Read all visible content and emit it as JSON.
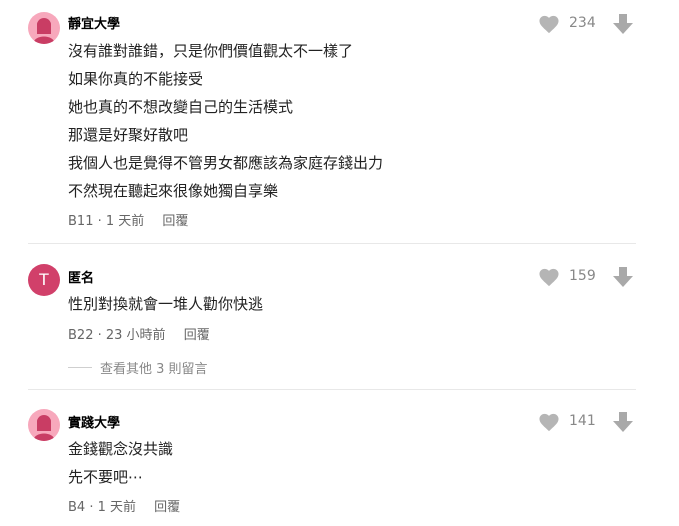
{
  "comments": [
    {
      "author": "靜宜大學",
      "lines": [
        "沒有誰對誰錯，只是你們價值觀太不一樣了",
        "如果你真的不能接受",
        "她也真的不想改變自己的生活模式",
        "那還是好聚好散吧",
        "我個人也是覺得不管男女都應該為家庭存錢出力",
        "不然現在聽起來很像她獨自享樂"
      ],
      "floor": "B11",
      "time": "1 天前",
      "reply_label": "回覆",
      "likes": "234"
    },
    {
      "author": "匿名",
      "avatar_letter": "T",
      "lines": [
        "性別對換就會一堆人勸你快逃"
      ],
      "floor": "B22",
      "time": "23 小時前",
      "reply_label": "回覆",
      "likes": "159",
      "more_replies": "查看其他 3 則留言"
    },
    {
      "author": "實踐大學",
      "lines": [
        "金錢觀念沒共識",
        "先不要吧⋯"
      ],
      "floor": "B4",
      "time": "1 天前",
      "reply_label": "回覆",
      "likes": "141"
    }
  ],
  "separator": " · ",
  "colors": {
    "avatar_pink": "#f7a8bc",
    "avatar_anon": "#d1406a",
    "icon_gray": "#b5b5b5"
  },
  "icons": {
    "like": "heart-icon",
    "dislike": "down-arrow-icon"
  }
}
